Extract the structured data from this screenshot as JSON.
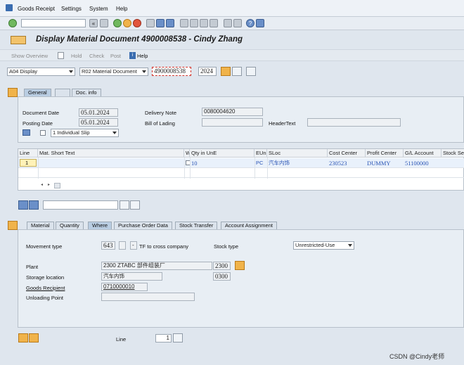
{
  "menu": [
    "Goods Receipt",
    "Settings",
    "System",
    "Help"
  ],
  "toolbar": {
    "command_field": ""
  },
  "title": "Display Material Document 4900008538 - Cindy Zhang",
  "apptb": {
    "show_overview": "Show Overview",
    "hold": "Hold",
    "check": "Check",
    "post": "Post",
    "help": "Help"
  },
  "selection": {
    "action": "A04 Display",
    "ref": "R02 Material Document",
    "doc_no": "4900008538",
    "year": "2024"
  },
  "header_tabs": [
    "General",
    "Doc. info"
  ],
  "header": {
    "doc_date_label": "Document Date",
    "doc_date": "05.01.2024",
    "post_date_label": "Posting Date",
    "post_date": "05.01.2024",
    "delivery_note_label": "Delivery Note",
    "delivery_note": "0080004620",
    "bill_label": "Bill of Lading",
    "bill": "",
    "header_text_label": "HeaderText",
    "header_text": "",
    "slip": "1 Individual Slip"
  },
  "grid": {
    "headers": [
      "Line",
      "Mat. Short Text",
      "W",
      "Qty in UnE",
      "EUn",
      "SLoc",
      "Cost Center",
      "Profit Center",
      "G/L Account",
      "Stock Se"
    ],
    "row": {
      "line": "1",
      "text": "",
      "qty": "10",
      "eun": "PC",
      "sloc": "汽车内饰",
      "cost_center": "230523",
      "profit_center": "DUMMY",
      "gl": "51100000"
    }
  },
  "item_tabs": [
    "Material",
    "Quantity",
    "Where",
    "Purchase Order Data",
    "Stock Transfer",
    "Account Assignment"
  ],
  "where": {
    "mvt_label": "Movement type",
    "mvt": "643",
    "mvt_ind": "",
    "mvt_sign": "-",
    "mvt_text": "TF to cross company",
    "stock_type_label": "Stock type",
    "stock_type": "Unrestricted-Use",
    "plant_label": "Plant",
    "plant": "2300 ZTABC 部件组装厂",
    "plant_code": "2300",
    "sloc_label": "Storage location",
    "sloc": "汽车内饰",
    "sloc_code": "0300",
    "recipient_label": "Goods Recipient",
    "recipient": "0710000010",
    "unload_label": "Unloading Point",
    "unload": ""
  },
  "footer": {
    "line_label": "Line",
    "line_value": "1"
  },
  "watermark": "CSDN @Cindy老师"
}
